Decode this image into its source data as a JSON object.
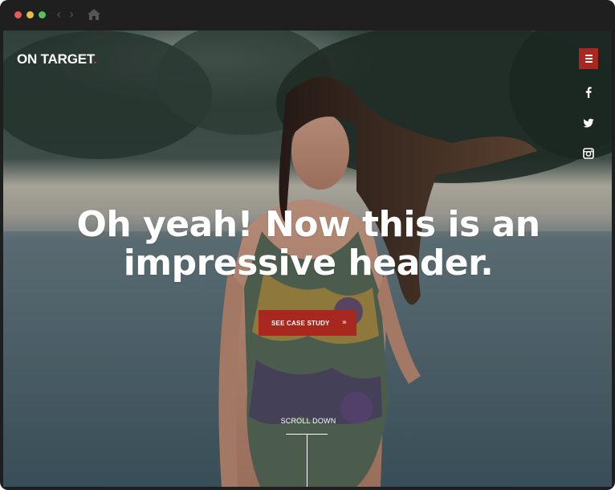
{
  "browser": {
    "icons": [
      "close-dot",
      "minimize-dot",
      "maximize-dot",
      "back-arrow-icon",
      "forward-arrow-icon",
      "home-icon"
    ],
    "back_glyph": "‹",
    "forward_glyph": "›"
  },
  "header": {
    "logo_text": "ON TARGET",
    "logo_accent": ".",
    "menu_icon": "hamburger-icon"
  },
  "social": [
    {
      "name": "facebook",
      "icon": "facebook-icon"
    },
    {
      "name": "twitter",
      "icon": "twitter-icon"
    },
    {
      "name": "instagram",
      "icon": "instagram-icon"
    }
  ],
  "hero": {
    "headline_line1": "Oh yeah! Now this is an",
    "headline_line2": "impressive header.",
    "cta_label": "SEE CASE STUDY",
    "cta_icon": "»",
    "scroll_label": "SCROLL DOWN"
  },
  "colors": {
    "accent": "#a8271e",
    "text": "#ffffff",
    "chrome": "#1f1f1f"
  }
}
